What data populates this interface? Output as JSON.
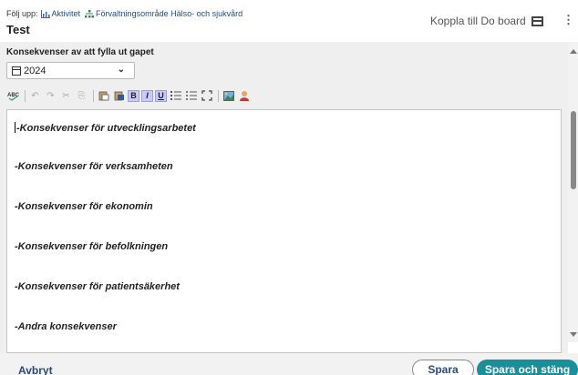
{
  "header": {
    "follow_label": "Följ upp:",
    "activity_label": "Aktivitet",
    "area_label": "Förvaltningsområde Hälso- och sjukvård",
    "title": "Test",
    "do_board_label": "Koppla till Do board",
    "more_label": "⋮"
  },
  "section": {
    "title": "Konsekvenser av att fylla ut gapet",
    "year_value": "2024"
  },
  "toolbar": {
    "icons": [
      "spellcheck-icon",
      "undo-icon",
      "redo-icon",
      "cut-icon",
      "copy-icon",
      "paste-icon",
      "paste-word-icon",
      "bold-icon",
      "italic-icon",
      "underline-icon",
      "ordered-list-icon",
      "unordered-list-icon",
      "maximize-icon",
      "image-icon",
      "user-icon"
    ],
    "bold_label": "B",
    "italic_label": "I",
    "underline_label": "U"
  },
  "editor": {
    "lines": [
      "-Konsekvenser för utvecklingsarbetet",
      "-Konsekvenser för verksamheten",
      "-Konsekvenser för ekonomin",
      "-Konsekvenser för befolkningen",
      "-Konsekvenser för patientsäkerhet",
      "-Andra konsekvenser"
    ]
  },
  "footer": {
    "cancel_label": "Avbryt",
    "save_label": "Spara",
    "save_close_label": "Spara och stäng"
  },
  "colors": {
    "primary_button": "#1a8f9a",
    "link": "#2c4a75"
  }
}
